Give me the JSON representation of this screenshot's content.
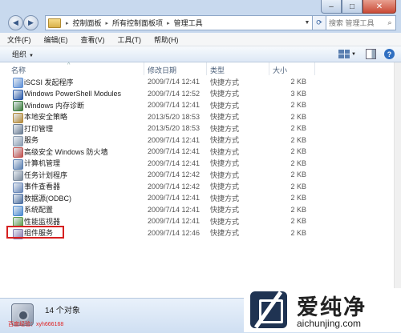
{
  "window": {
    "minimize_glyph": "‒",
    "maximize_glyph": "□",
    "close_glyph": "✕"
  },
  "address": {
    "crumbs": [
      "控制面板",
      "所有控制面板项",
      "管理工具"
    ],
    "separator": "▸",
    "search_placeholder": "搜索 管理工具"
  },
  "menu": {
    "items": [
      "文件(F)",
      "编辑(E)",
      "查看(V)",
      "工具(T)",
      "帮助(H)"
    ]
  },
  "command_bar": {
    "organize_label": "组织",
    "organize_arrow": "▼"
  },
  "columns": {
    "name": "名称",
    "date": "修改日期",
    "type": "类型",
    "size": "大小",
    "sort_arrow": "^"
  },
  "files": [
    {
      "name": "iSCSI 发起程序",
      "date": "2009/7/14 12:41",
      "type": "快捷方式",
      "size": "2 KB",
      "icon_color": "#5d8fd6"
    },
    {
      "name": "Windows PowerShell Modules",
      "date": "2009/7/14 12:52",
      "type": "快捷方式",
      "size": "3 KB",
      "icon_color": "#2a5aa8"
    },
    {
      "name": "Windows 内存诊断",
      "date": "2009/7/14 12:41",
      "type": "快捷方式",
      "size": "2 KB",
      "icon_color": "#3a7a3a"
    },
    {
      "name": "本地安全策略",
      "date": "2013/5/20 18:53",
      "type": "快捷方式",
      "size": "2 KB",
      "icon_color": "#b48a3a"
    },
    {
      "name": "打印管理",
      "date": "2013/5/20 18:53",
      "type": "快捷方式",
      "size": "2 KB",
      "icon_color": "#6b7d93"
    },
    {
      "name": "服务",
      "date": "2009/7/14 12:41",
      "type": "快捷方式",
      "size": "2 KB",
      "icon_color": "#8a9bb0"
    },
    {
      "name": "高级安全 Windows 防火墙",
      "date": "2009/7/14 12:41",
      "type": "快捷方式",
      "size": "2 KB",
      "icon_color": "#c0504d"
    },
    {
      "name": "计算机管理",
      "date": "2009/7/14 12:41",
      "type": "快捷方式",
      "size": "2 KB",
      "icon_color": "#5a7fb0"
    },
    {
      "name": "任务计划程序",
      "date": "2009/7/14 12:42",
      "type": "快捷方式",
      "size": "2 KB",
      "icon_color": "#7a8a9c"
    },
    {
      "name": "事件查看器",
      "date": "2009/7/14 12:42",
      "type": "快捷方式",
      "size": "2 KB",
      "icon_color": "#6a88b8"
    },
    {
      "name": "数据源(ODBC)",
      "date": "2009/7/14 12:41",
      "type": "快捷方式",
      "size": "2 KB",
      "icon_color": "#4d6fa0"
    },
    {
      "name": "系统配置",
      "date": "2009/7/14 12:41",
      "type": "快捷方式",
      "size": "2 KB",
      "icon_color": "#4a8ad0"
    },
    {
      "name": "性能监视器",
      "date": "2009/7/14 12:41",
      "type": "快捷方式",
      "size": "2 KB",
      "icon_color": "#5b9a4a"
    },
    {
      "name": "组件服务",
      "date": "2009/7/14 12:46",
      "type": "快捷方式",
      "size": "2 KB",
      "icon_color": "#8a7ab0"
    }
  ],
  "details": {
    "count": "14 个对象"
  },
  "watermark": {
    "left_text": "百度经验：xyh666168",
    "logo_cn": "爱纯净",
    "logo_url": "aichunjing.com"
  }
}
